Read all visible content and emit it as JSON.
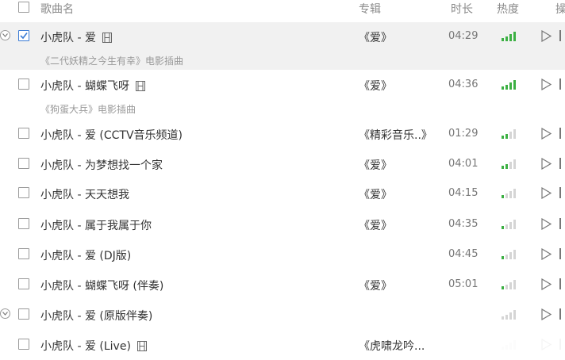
{
  "header": {
    "col_song": "歌曲名",
    "col_album": "专辑",
    "col_duration": "时长",
    "col_heat": "热度",
    "col_ops": "操"
  },
  "songs": [
    {
      "title": "小虎队 - 爱",
      "has_mv": true,
      "subtitle": "《二代妖精之今生有幸》电影插曲",
      "album": "《爱》",
      "duration": "04:29",
      "heat": 4,
      "checked": true,
      "selected": true,
      "expand_icon": true
    },
    {
      "title": "小虎队 - 蝴蝶飞呀",
      "has_mv": true,
      "subtitle": "《狗蛋大兵》电影插曲",
      "album": "《爱》",
      "duration": "04:36",
      "heat": 4,
      "checked": false,
      "selected": false,
      "expand_icon": false
    },
    {
      "title": "小虎队 - 爱 (CCTV音乐频道)",
      "has_mv": false,
      "subtitle": "",
      "album": "《精彩音乐..》",
      "duration": "01:29",
      "heat": 2,
      "checked": false,
      "selected": false,
      "expand_icon": false
    },
    {
      "title": "小虎队 - 为梦想找一个家",
      "has_mv": false,
      "subtitle": "",
      "album": "《爱》",
      "duration": "04:01",
      "heat": 2,
      "checked": false,
      "selected": false,
      "expand_icon": false
    },
    {
      "title": "小虎队 - 天天想我",
      "has_mv": false,
      "subtitle": "",
      "album": "《爱》",
      "duration": "04:15",
      "heat": 1,
      "checked": false,
      "selected": false,
      "expand_icon": false
    },
    {
      "title": "小虎队 - 属于我属于你",
      "has_mv": false,
      "subtitle": "",
      "album": "《爱》",
      "duration": "04:35",
      "heat": 1,
      "checked": false,
      "selected": false,
      "expand_icon": false
    },
    {
      "title": "小虎队 - 爱 (DJ版)",
      "has_mv": false,
      "subtitle": "",
      "album": "",
      "duration": "04:45",
      "heat": 1,
      "checked": false,
      "selected": false,
      "expand_icon": false
    },
    {
      "title": "小虎队 - 蝴蝶飞呀 (伴奏)",
      "has_mv": false,
      "subtitle": "",
      "album": "《爱》",
      "duration": "05:01",
      "heat": 1,
      "checked": false,
      "selected": false,
      "expand_icon": false
    },
    {
      "title": "小虎队 - 爱 (原版伴奏)",
      "has_mv": false,
      "subtitle": "",
      "album": "",
      "duration": "",
      "heat": 0,
      "checked": false,
      "selected": false,
      "expand_icon": true
    },
    {
      "title": "小虎队 - 爱 (Live)",
      "has_mv": true,
      "subtitle": "",
      "album": "《虎啸龙吟...",
      "duration": "",
      "heat": 0,
      "checked": false,
      "selected": false,
      "expand_icon": false
    }
  ],
  "colors": {
    "heat_on": "#3cb043",
    "heat_off": "#d5d5d5",
    "check_blue": "#3a7bd5"
  },
  "icons": {
    "mv": "film-icon",
    "play": "play-icon",
    "expand": "chevron-down-icon"
  }
}
